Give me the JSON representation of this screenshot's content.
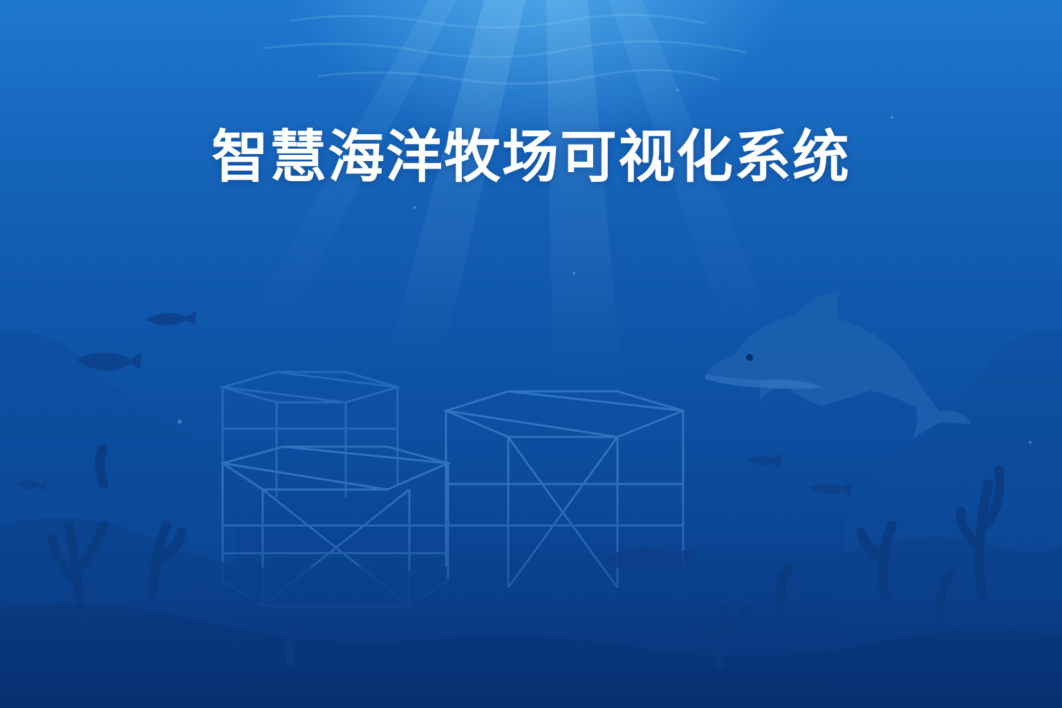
{
  "title": "智慧海洋牧场可视化系统",
  "colors": {
    "ocean_top": "#1f78cf",
    "ocean_bottom": "#093983",
    "light_rays": "#8fd8ff",
    "silhouette": "#0c3f86",
    "net_cage_lines": "#4c93da",
    "title_text": "#ffffff"
  },
  "icons": [
    "dolphin-icon",
    "fish-icon",
    "coral-icon",
    "net-cage-icon"
  ]
}
